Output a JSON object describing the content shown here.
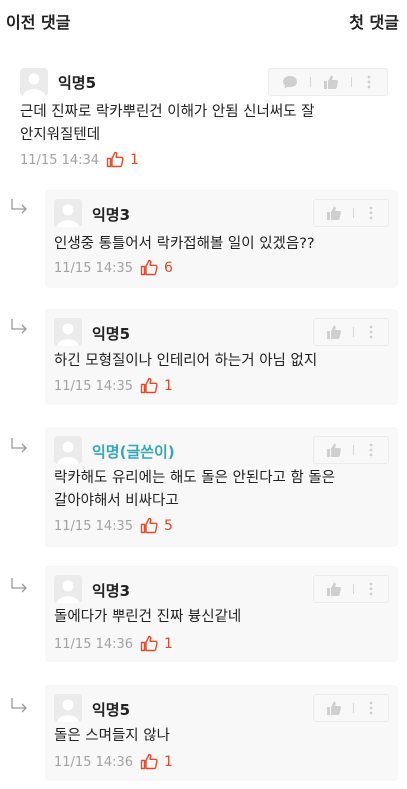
{
  "topbar": {
    "prev_label": "이전 댓글",
    "first_label": "첫 댓글"
  },
  "comment": {
    "author": "익명5",
    "text": "근데 진짜로 락카뿌린건 이해가 안됨 신너써도 잘\n안지워질텐데",
    "time": "11/15 14:34",
    "likes": "1"
  },
  "replies": [
    {
      "author": "익명3",
      "text": "인생중 통틀어서 락카접해볼 일이 있겠음??",
      "time": "11/15 14:35",
      "likes": "6"
    },
    {
      "author": "익명5",
      "text": "하긴 모형질이나 인테리어 하는거 아님 없지",
      "time": "11/15 14:35",
      "likes": "1"
    },
    {
      "author": "익명(글쓴이)",
      "text": "락카해도 유리에는 해도 돌은 안된다고 함 돌은\n갈아야해서 비싸다고",
      "time": "11/15 14:35",
      "likes": "5"
    },
    {
      "author": "익명3",
      "text": "돌에다가 뿌린건 진짜 븅신같네",
      "time": "11/15 14:36",
      "likes": "1"
    },
    {
      "author": "익명5",
      "text": "돌은 스며들지 않나",
      "time": "11/15 14:36",
      "likes": "1"
    }
  ],
  "colors": {
    "like_accent": "#e14b2b",
    "op_author": "#33a8b8",
    "muted": "#a3a3a3",
    "card_bg": "#f8f8f8"
  },
  "icons": [
    "reply-bubble-icon",
    "thumbs-up-icon",
    "more-vertical-icon",
    "reply-arrow-icon",
    "heart-like-icon",
    "avatar-silhouette-icon"
  ]
}
